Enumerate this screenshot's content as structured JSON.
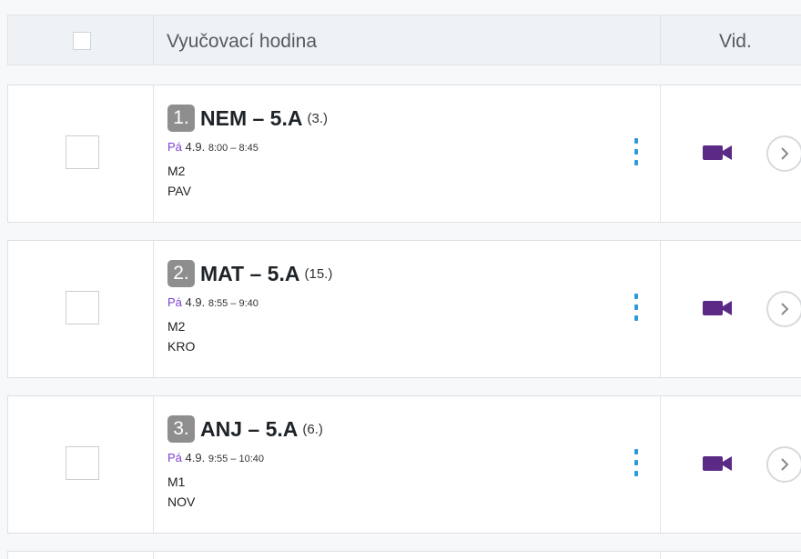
{
  "header": {
    "lesson_col": "Vyučovací hodina",
    "video_col": "Vid."
  },
  "colors": {
    "day_accent": "#7b3fd1",
    "menu_accent": "#2a9ad8",
    "video_icon": "#5b2a86",
    "badge_bg": "#8e8e8e"
  },
  "lessons": [
    {
      "number": "1.",
      "subject": "NEM – 5.A",
      "count": "(3.)",
      "day": "Pá",
      "date": "4.9.",
      "time": "8:00 – 8:45",
      "room": "M2",
      "teacher": "PAV",
      "menu_icon": "kebab-menu-icon",
      "video_icon": "video-camera-icon",
      "open_icon": "chevron-right-icon"
    },
    {
      "number": "2.",
      "subject": "MAT – 5.A",
      "count": "(15.)",
      "day": "Pá",
      "date": "4.9.",
      "time": "8:55 – 9:40",
      "room": "M2",
      "teacher": "KRO",
      "menu_icon": "kebab-menu-icon",
      "video_icon": "video-camera-icon",
      "open_icon": "chevron-right-icon"
    },
    {
      "number": "3.",
      "subject": "ANJ – 5.A",
      "count": "(6.)",
      "day": "Pá",
      "date": "4.9.",
      "time": "9:55 – 10:40",
      "room": "M1",
      "teacher": "NOV",
      "menu_icon": "kebab-menu-icon",
      "video_icon": "video-camera-icon",
      "open_icon": "chevron-right-icon"
    }
  ]
}
